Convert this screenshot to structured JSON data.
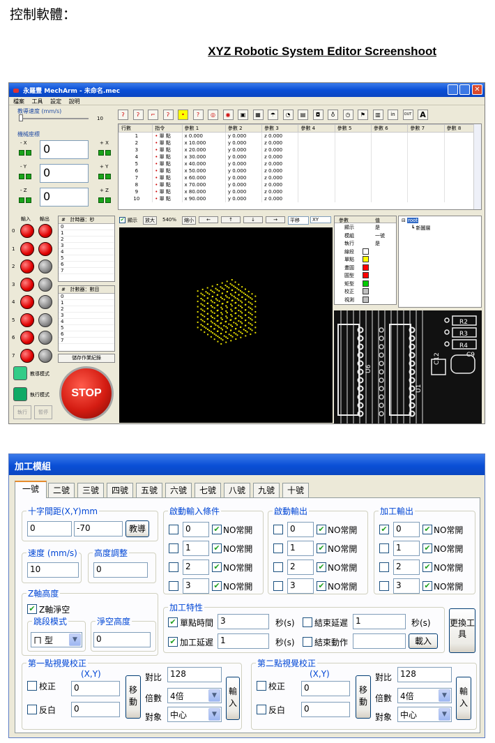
{
  "page": {
    "heading": "控制軟體：",
    "subtitle": "XYZ Robotic System Editor Screenshoot"
  },
  "app1": {
    "title": "永羅豐 MechArm - 未命名.mec",
    "menu": [
      "檔案",
      "工具",
      "設定",
      "說明"
    ],
    "speed_label": "教導速度 (mm/s)",
    "speed_value": "10",
    "coord_label": "機械座標",
    "axes": [
      {
        "minus": "- X",
        "plus": "+ X",
        "value": "0"
      },
      {
        "minus": "- Y",
        "plus": "+ Y",
        "value": "0"
      },
      {
        "minus": "- Z",
        "plus": "+ Z",
        "value": "0"
      }
    ],
    "toolbar_text": [
      "in",
      "OUT",
      "A"
    ],
    "table": {
      "headers": [
        "行數",
        "指令",
        "參數 1",
        "參數 2",
        "參數 3",
        "參數 4",
        "參數 5",
        "參數 6",
        "參數 7",
        "參數 8"
      ],
      "rows": [
        [
          "1",
          "單 點",
          "x 0.000",
          "y 0.000",
          "z 0.000"
        ],
        [
          "2",
          "單 點",
          "x 10.000",
          "y 0.000",
          "z 0.000"
        ],
        [
          "3",
          "單 點",
          "x 20.000",
          "y 0.000",
          "z 0.000"
        ],
        [
          "4",
          "單 點",
          "x 30.000",
          "y 0.000",
          "z 0.000"
        ],
        [
          "5",
          "單 點",
          "x 40.000",
          "y 0.000",
          "z 0.000"
        ],
        [
          "6",
          "單 點",
          "x 50.000",
          "y 0.000",
          "z 0.000"
        ],
        [
          "7",
          "單 點",
          "x 60.000",
          "y 0.000",
          "z 0.000"
        ],
        [
          "8",
          "單 點",
          "x 70.000",
          "y 0.000",
          "z 0.000"
        ],
        [
          "9",
          "單 點",
          "x 80.000",
          "y 0.000",
          "z 0.000"
        ],
        [
          "10",
          "單 點",
          "x 90.000",
          "y 0.000",
          "z 0.000"
        ]
      ]
    },
    "io": {
      "in_label": "輸入",
      "out_label": "輸出",
      "rows": [
        "0",
        "1",
        "2",
        "3",
        "4",
        "5",
        "6",
        "7"
      ]
    },
    "timer_label": "計時器：秒",
    "counter_label": "計數器：數目",
    "counter_rows": [
      "0",
      "1",
      "2",
      "3",
      "4",
      "5",
      "6",
      "7"
    ],
    "save_log": "儲存作業紀錄",
    "teach_mode": "教導模式",
    "run_mode": "執行模式",
    "run_btn": "執行",
    "pause_btn": "暫停",
    "stop_btn": "STOP",
    "view": {
      "show": "顯示",
      "zoom_in": "放大",
      "zoom_pct": "540%",
      "zoom_out": "縮小",
      "arrows": [
        "←",
        "↑",
        "↓",
        "→"
      ],
      "pan": "平移",
      "plane": "XY"
    },
    "props": {
      "h1": "參數",
      "h2": "值",
      "rows": [
        {
          "k": "顯示",
          "v": "是"
        },
        {
          "k": "模組",
          "v": "一號"
        },
        {
          "k": "執行",
          "v": "是"
        },
        {
          "k": "線段",
          "v": "",
          "color": "#ffffff"
        },
        {
          "k": "單點",
          "v": "",
          "color": "#ffff00"
        },
        {
          "k": "畫圓",
          "v": "",
          "color": "#ff0000"
        },
        {
          "k": "圓型",
          "v": "",
          "color": "#ff0000"
        },
        {
          "k": "矩型",
          "v": "",
          "color": "#00cc00"
        },
        {
          "k": "校正",
          "v": "",
          "color": "#c0c0c0"
        },
        {
          "k": "視測",
          "v": "",
          "color": "#c0c0c0"
        }
      ]
    },
    "tree": {
      "root": "root",
      "child": "新圖層"
    },
    "pcb_labels": [
      "R2",
      "R3",
      "R4",
      "C9",
      "C12",
      "U6",
      "U1"
    ]
  },
  "app2": {
    "title": "加工模組",
    "tabs": [
      "一號",
      "二號",
      "三號",
      "四號",
      "五號",
      "六號",
      "七號",
      "八號",
      "九號",
      "十號"
    ],
    "cross": {
      "label": "十字間距(X,Y)mm",
      "x": "0",
      "y": "-70",
      "teach": "教導"
    },
    "speed": {
      "label": "速度 (mm/s)",
      "value": "10"
    },
    "height": {
      "label": "高度調整",
      "value": "0"
    },
    "z": {
      "label": "Z軸高度",
      "check": "Z軸淨空",
      "mode_label": "跳段模式",
      "mode_value": "ㄇ 型",
      "clear_label": "淨空高度",
      "clear_value": "0"
    },
    "start_input": {
      "label": "啟動輸入條件",
      "rows": [
        "0",
        "1",
        "2",
        "3"
      ],
      "no": "NO常開"
    },
    "start_output": {
      "label": "啟動輸出",
      "rows": [
        "0",
        "1",
        "2",
        "3"
      ],
      "no": "NO常開"
    },
    "proc_output": {
      "label": "加工輸出",
      "rows": [
        "0",
        "1",
        "2",
        "3"
      ],
      "no": "NO常開"
    },
    "proc": {
      "label": "加工特性",
      "point_time": "單點時間",
      "point_time_value": "3",
      "proc_delay": "加工延遲",
      "proc_delay_value": "1",
      "sec": "秒(s)",
      "end_delay": "結束延遲",
      "end_delay_value": "1",
      "sec2": "秒(s)",
      "end_action": "結束動作",
      "load": "載入",
      "change_tool": "更換工具"
    },
    "vis1": {
      "label": "第一點視覺校正",
      "xy": "(X,Y)",
      "calib": "校正",
      "invert": "反白",
      "x": "0",
      "y": "0",
      "move": "移動",
      "contrast": "對比",
      "contrast_value": "128",
      "mult": "倍數",
      "mult_value": "4倍",
      "target": "對象",
      "target_value": "中心",
      "input": "輸入"
    },
    "vis2": {
      "label": "第二點視覺校正",
      "xy": "(X,Y)",
      "calib": "校正",
      "invert": "反白",
      "x": "0",
      "y": "0",
      "move": "移動",
      "contrast": "對比",
      "contrast_value": "128",
      "mult": "倍數",
      "mult_value": "4倍",
      "target": "對象",
      "target_value": "中心",
      "input": "輸入"
    }
  }
}
